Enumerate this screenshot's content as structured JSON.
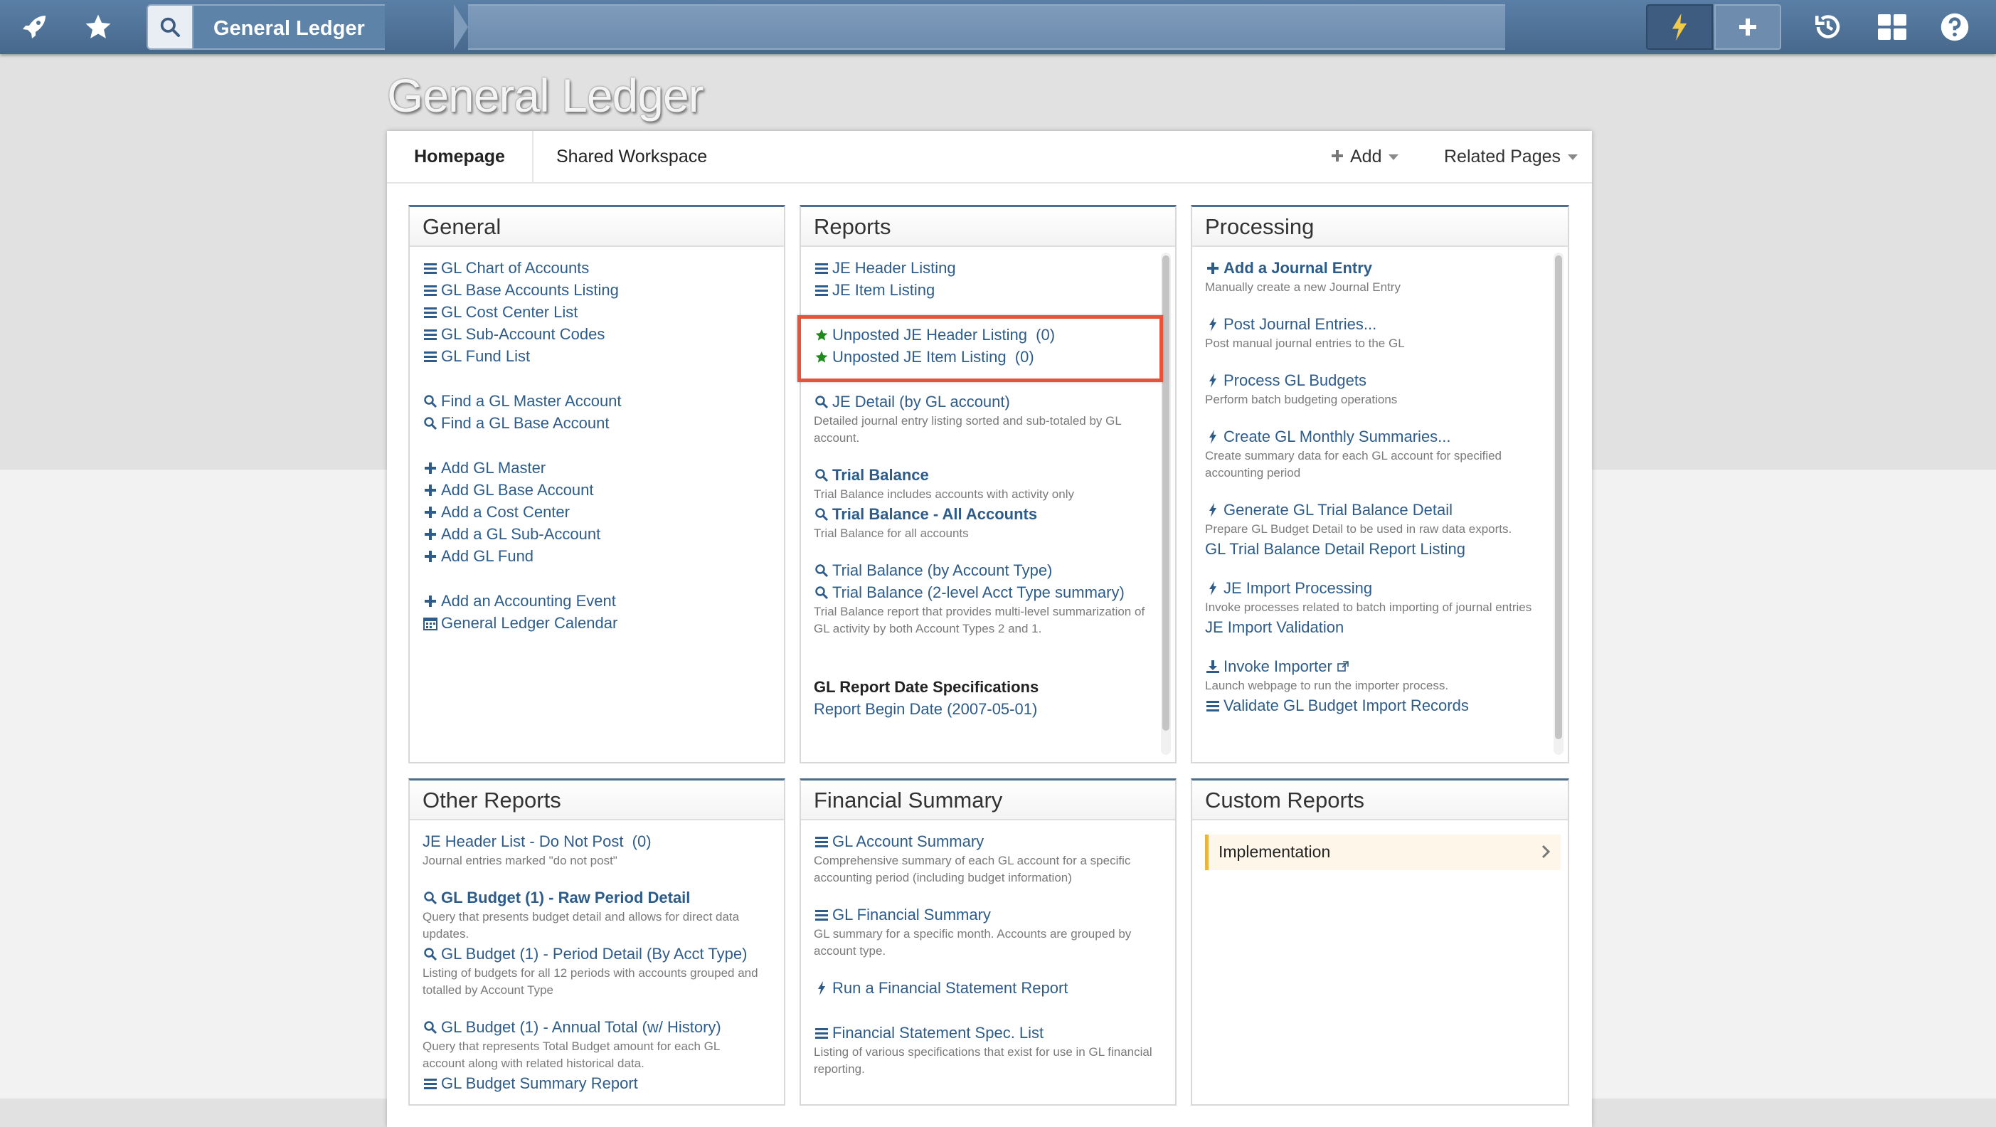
{
  "topbar": {
    "icons": [
      "rocket-icon",
      "star-icon",
      "search-icon",
      "bolt-icon",
      "plus-icon",
      "history-icon",
      "grid-icon",
      "help-icon"
    ],
    "breadcrumb": "General Ledger"
  },
  "page_title": "General Ledger",
  "tabs": {
    "home": "Homepage",
    "shared": "Shared Workspace",
    "add": "Add",
    "related": "Related Pages"
  },
  "general": {
    "title": "General",
    "items": [
      "GL Chart of Accounts",
      "GL Base Accounts Listing",
      "GL Cost Center List",
      "GL Sub-Account Codes",
      "GL Fund List",
      "Find a GL Master Account",
      "Find a GL Base Account",
      "Add GL Master",
      "Add GL Base Account",
      "Add a Cost Center",
      "Add a GL Sub-Account",
      "Add GL Fund",
      "Add an Accounting Event",
      "General Ledger Calendar"
    ]
  },
  "reports": {
    "title": "Reports",
    "je_header": "JE Header Listing",
    "je_item": "JE Item Listing",
    "unposted_header": "Unposted JE Header Listing  (0)",
    "unposted_item": "Unposted JE Item Listing  (0)",
    "je_detail": "JE Detail (by GL account)",
    "je_detail_desc": "Detailed journal entry listing sorted and sub-totaled by GL account.",
    "trial_balance": "Trial Balance",
    "trial_balance_desc": "Trial Balance includes accounts with activity only",
    "trial_balance_all": "Trial Balance - All Accounts",
    "trial_balance_all_desc": "Trial Balance for all accounts",
    "tb_acct_type": "Trial Balance (by Account Type)",
    "tb_2level": "Trial Balance (2-level Acct Type summary)",
    "tb_2level_desc": "Trial Balance report that provides multi-level summarization of GL activity by both Account Types 2 and 1.",
    "date_spec_heading": "GL Report Date Specifications",
    "date_spec_begin": "Report Begin Date (2007-05-01)"
  },
  "processing": {
    "title": "Processing",
    "add_je": "Add a Journal Entry",
    "add_je_desc": "Manually create a new Journal Entry",
    "post_je": "Post Journal Entries...",
    "post_je_desc": "Post manual journal entries to the GL",
    "process_budgets": "Process GL Budgets",
    "process_budgets_desc": "Perform batch budgeting operations",
    "monthly": "Create GL Monthly Summaries...",
    "monthly_desc": "Create summary data for each GL account for specified accounting period",
    "gen_tb": "Generate GL Trial Balance Detail",
    "gen_tb_desc": "Prepare GL Budget Detail to be used in raw data exports.",
    "tb_report_listing": "GL Trial Balance Detail Report Listing",
    "je_import": "JE Import Processing",
    "je_import_desc": "Invoke processes related to batch importing of journal entries",
    "je_import_validation": "JE Import Validation",
    "invoke_importer": "Invoke Importer",
    "invoke_importer_desc": "Launch webpage to run the importer process.",
    "validate_budget": "Validate GL Budget Import Records"
  },
  "other_reports": {
    "title": "Other Reports",
    "je_dnp": "JE Header List - Do Not Post  (0)",
    "je_dnp_desc": "Journal entries marked \"do not post\"",
    "budget_raw": "GL Budget (1) - Raw Period Detail",
    "budget_raw_desc": "Query that presents budget detail and allows for direct data updates.",
    "budget_period": "GL Budget (1) - Period Detail (By Acct Type)",
    "budget_period_desc": "Listing of budgets for all 12 periods with accounts grouped and totalled by Account Type",
    "budget_annual": "GL Budget (1) - Annual Total (w/ History)",
    "budget_annual_desc": "Query that represents Total Budget amount for each GL account along with related historical data.",
    "budget_summary": "GL Budget Summary Report"
  },
  "financial_summary": {
    "title": "Financial Summary",
    "account_summary": "GL Account Summary",
    "account_summary_desc": "Comprehensive summary of each GL account for a specific accounting period (including budget information)",
    "financial_summary": "GL Financial Summary",
    "financial_summary_desc": "GL summary for a specific month. Accounts are grouped by account type.",
    "run_fs": "Run a Financial Statement Report",
    "fs_spec": "Financial Statement Spec. List",
    "fs_spec_desc": "Listing of various specifications that exist for use in GL financial reporting."
  },
  "custom_reports": {
    "title": "Custom Reports",
    "implementation": "Implementation"
  },
  "colors": {
    "link": "#2e5c8a",
    "highlight": "#e5533c",
    "star": "#1e8a1e",
    "topbar": "#4e7298"
  }
}
